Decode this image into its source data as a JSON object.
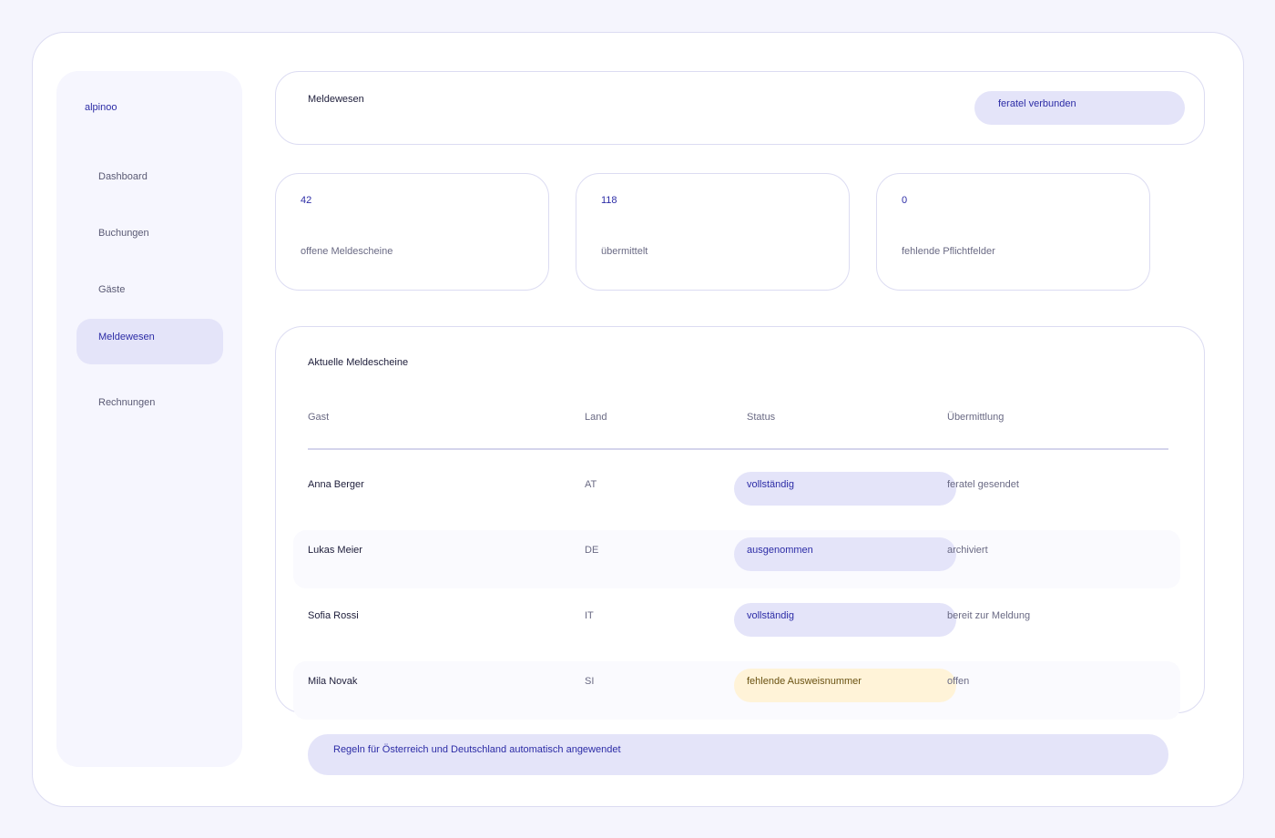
{
  "app": {
    "brand": "alpinoo"
  },
  "sidebar": {
    "items": [
      {
        "label": "Dashboard",
        "active": false
      },
      {
        "label": "Buchungen",
        "active": false
      },
      {
        "label": "Gäste",
        "active": false
      },
      {
        "label": "Meldewesen",
        "active": true
      },
      {
        "label": "Rechnungen",
        "active": false
      }
    ]
  },
  "header": {
    "title": "Meldewesen",
    "connection_status": "feratel verbunden"
  },
  "stats": [
    {
      "value": "42",
      "label": "offene Meldescheine"
    },
    {
      "value": "118",
      "label": "übermittelt"
    },
    {
      "value": "0",
      "label": "fehlende Pflichtfelder"
    }
  ],
  "table": {
    "title": "Aktuelle Meldescheine",
    "columns": [
      "Gast",
      "Land",
      "Status",
      "Übermittlung"
    ],
    "rows": [
      {
        "guest": "Anna Berger",
        "country": "AT",
        "status": "vollständig",
        "status_kind": "ok",
        "transmission": "feratel gesendet"
      },
      {
        "guest": "Lukas Meier",
        "country": "DE",
        "status": "ausgenommen",
        "status_kind": "ok",
        "transmission": "archiviert"
      },
      {
        "guest": "Sofia Rossi",
        "country": "IT",
        "status": "vollständig",
        "status_kind": "ok",
        "transmission": "bereit zur Meldung"
      },
      {
        "guest": "Mila Novak",
        "country": "SI",
        "status": "fehlende Ausweisnummer",
        "status_kind": "warning",
        "transmission": "offen"
      }
    ]
  },
  "footer": {
    "notice": "Regeln für Österreich und Deutschland automatisch angewendet"
  },
  "colors": {
    "accent": "#2c2ca6",
    "accent_bg": "#e4e4f9",
    "warning_bg": "#fff3d8",
    "warning_text": "#6a5212"
  }
}
